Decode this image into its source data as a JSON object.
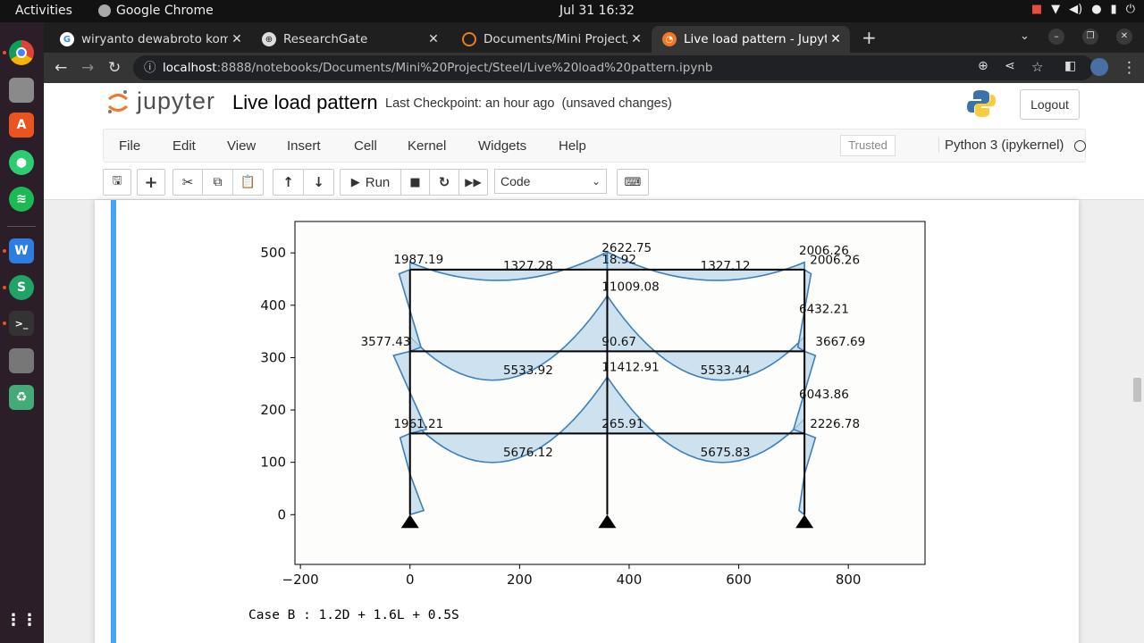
{
  "topbar": {
    "activities": "Activities",
    "app_name": "Google Chrome",
    "clock": "Jul 31  16:32"
  },
  "browser": {
    "tabs": [
      {
        "title": "wiryanto dewabroto kom",
        "icon": "google-icon"
      },
      {
        "title": "ResearchGate",
        "icon": "researchgate-icon"
      },
      {
        "title": "Documents/Mini Project/",
        "icon": "jupyter-loading-icon"
      },
      {
        "title": "Live load pattern - Jupyte",
        "icon": "jupyter-icon",
        "active": true
      }
    ],
    "url_host": "localhost",
    "url_rest": ":8888/notebooks/Documents/Mini%20Project/Steel/Live%20load%20pattern.ipynb"
  },
  "jupyter": {
    "logo_text": "jupyter",
    "notebook_name": "Live load pattern",
    "checkpoint": "Last Checkpoint: an hour ago",
    "unsaved": "(unsaved changes)",
    "logout": "Logout",
    "menus": [
      "File",
      "Edit",
      "View",
      "Insert",
      "Cell",
      "Kernel",
      "Widgets",
      "Help"
    ],
    "trusted": "Trusted",
    "kernel_name": "Python 3 (ipykernel)",
    "run_label": "Run",
    "cell_type": "Code"
  },
  "output": {
    "text": "Case B : 1.2D + 1.6L + 0.5S"
  },
  "chart_data": {
    "type": "line",
    "title": "",
    "xlabel": "",
    "ylabel": "",
    "xlim": [
      -210,
      940
    ],
    "ylim": [
      -95,
      560
    ],
    "xticks": [
      -200,
      0,
      200,
      400,
      600,
      800
    ],
    "xtick_labels": [
      "−200",
      "0",
      "200",
      "400",
      "600",
      "800"
    ],
    "yticks": [
      0,
      100,
      200,
      300,
      400,
      500
    ],
    "frame": {
      "columns_x": [
        0,
        360,
        720
      ],
      "floors_y": [
        0,
        155,
        312,
        468
      ]
    },
    "moment_labels": [
      {
        "x": -30,
        "y": 480,
        "text": "1987.19"
      },
      {
        "x": 170,
        "y": 468,
        "text": "1327.28"
      },
      {
        "x": 350,
        "y": 502,
        "text": "2622.75"
      },
      {
        "x": 350,
        "y": 480,
        "text": "18.92"
      },
      {
        "x": 530,
        "y": 468,
        "text": "1327.12"
      },
      {
        "x": 710,
        "y": 497,
        "text": "2006.26"
      },
      {
        "x": 730,
        "y": 479,
        "text": "2006.26"
      },
      {
        "x": 350,
        "y": 428,
        "text": "11009.08"
      },
      {
        "x": 710,
        "y": 385,
        "text": "6432.21"
      },
      {
        "x": -90,
        "y": 323,
        "text": "3577.43"
      },
      {
        "x": 350,
        "y": 323,
        "text": "90.67"
      },
      {
        "x": 740,
        "y": 323,
        "text": "3667.69"
      },
      {
        "x": 170,
        "y": 268,
        "text": "5533.92"
      },
      {
        "x": 350,
        "y": 274,
        "text": "11412.91"
      },
      {
        "x": 530,
        "y": 268,
        "text": "5533.44"
      },
      {
        "x": 710,
        "y": 222,
        "text": "6043.86"
      },
      {
        "x": -30,
        "y": 166,
        "text": "1961.21"
      },
      {
        "x": 350,
        "y": 166,
        "text": "265.91"
      },
      {
        "x": 730,
        "y": 166,
        "text": "2226.78"
      },
      {
        "x": 170,
        "y": 111,
        "text": "5676.12"
      },
      {
        "x": 530,
        "y": 111,
        "text": "5675.83"
      }
    ],
    "colors": {
      "diagram": "#3f7fb5",
      "fill": "#bcd7ea",
      "frame": "#000000"
    }
  }
}
